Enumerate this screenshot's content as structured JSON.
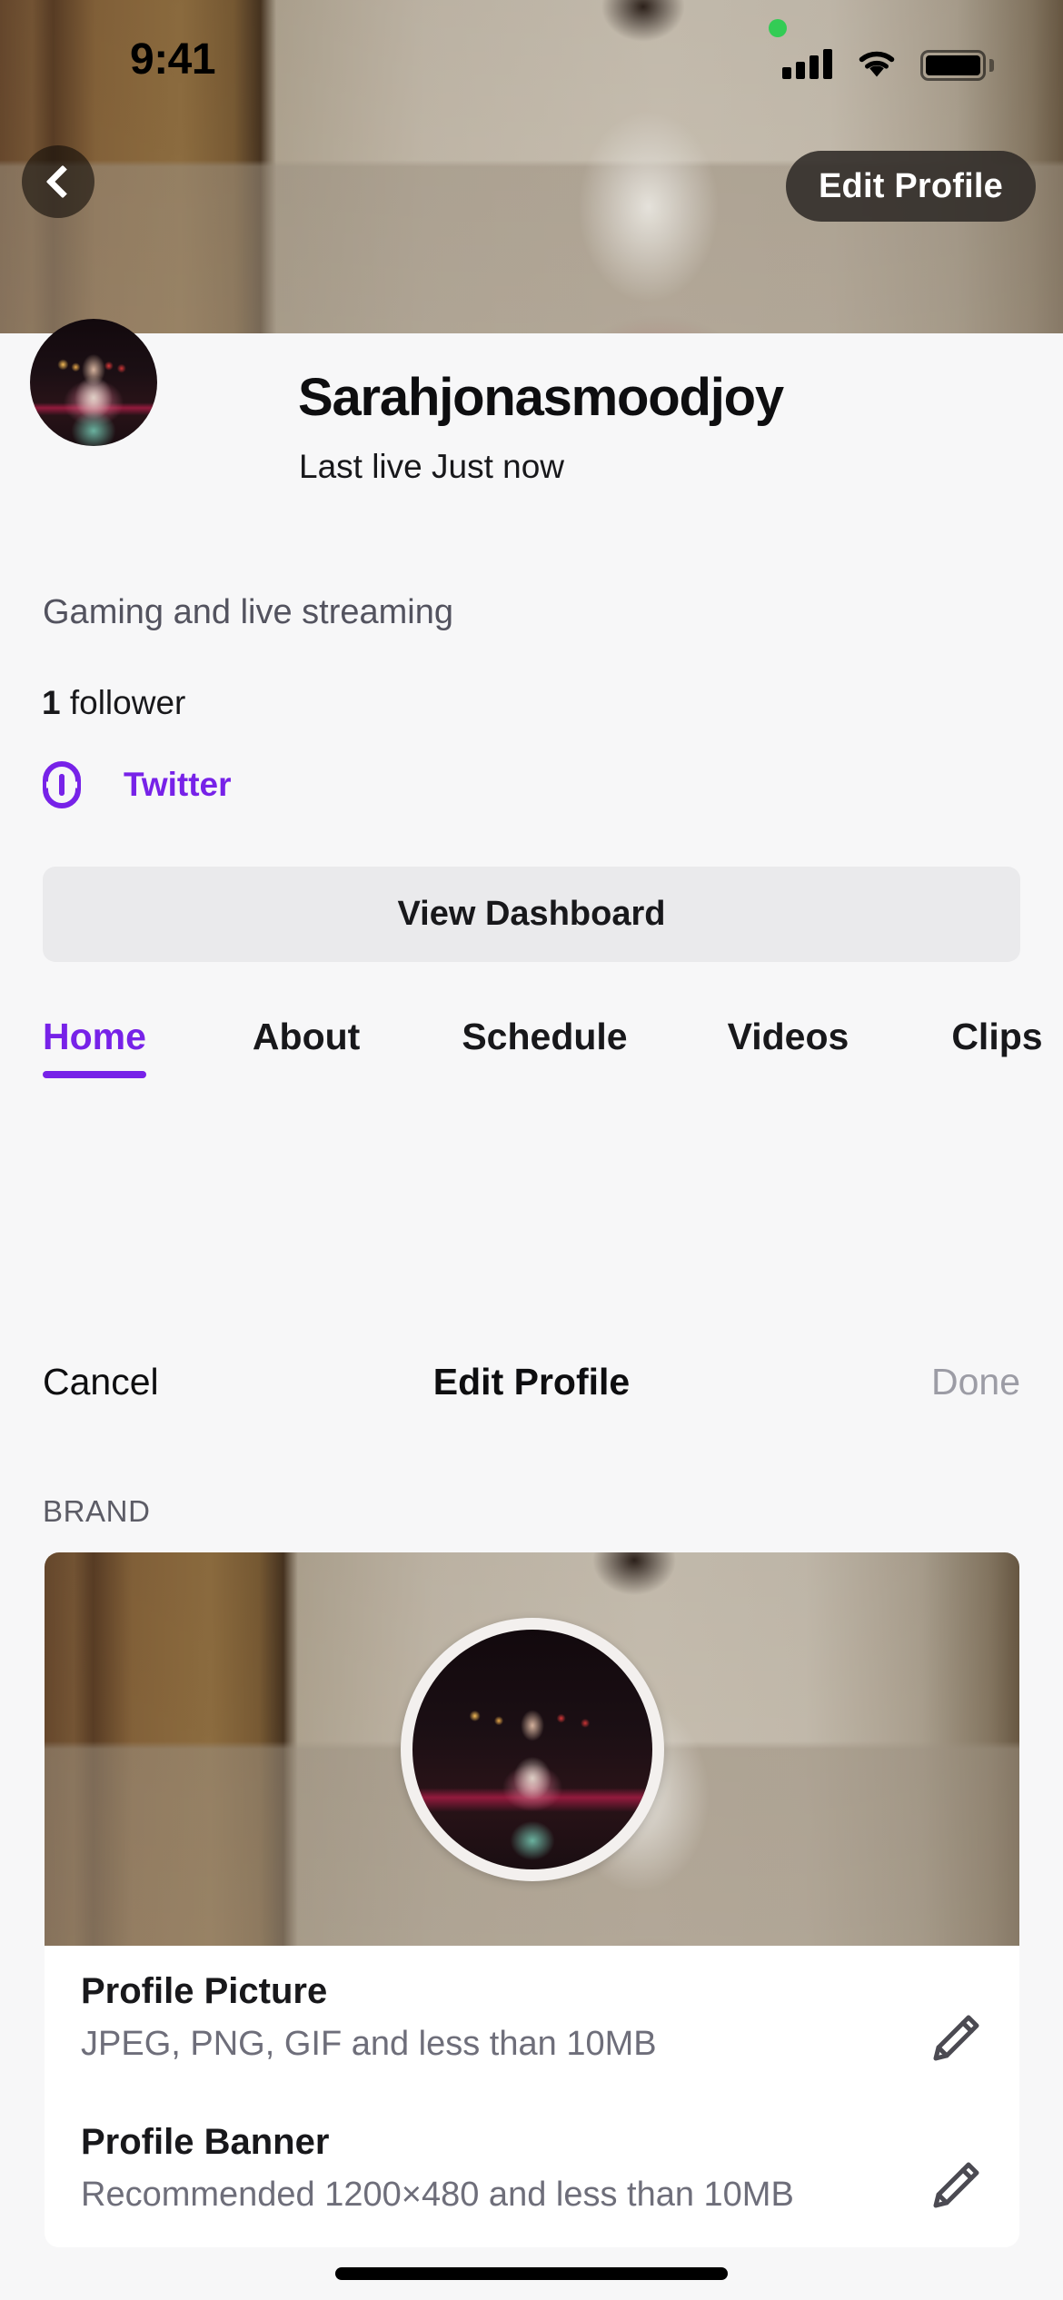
{
  "status_bar": {
    "time": "9:41",
    "icons": [
      "green-recording-dot",
      "cellular-signal-icon",
      "wifi-icon",
      "battery-icon"
    ],
    "battery_full": true
  },
  "banner_controls": {
    "back_icon": "chevron-left-icon",
    "edit_profile_label": "Edit Profile"
  },
  "profile": {
    "avatar_alt": "profile-avatar",
    "name": "Sarahjonasmoodjoy",
    "last_live": "Last live Just now",
    "bio": "Gaming and live streaming",
    "followers_count": "1",
    "followers_label": " follower",
    "social": {
      "icon": "link-icon",
      "label": "Twitter"
    },
    "dashboard_button": "View Dashboard"
  },
  "tabs": [
    {
      "label": "Home",
      "active": true
    },
    {
      "label": "About",
      "active": false
    },
    {
      "label": "Schedule",
      "active": false
    },
    {
      "label": "Videos",
      "active": false
    },
    {
      "label": "Clips",
      "active": false
    }
  ],
  "edit_sheet": {
    "cancel_label": "Cancel",
    "title": "Edit Profile",
    "done_label": "Done",
    "section_label": "BRAND",
    "rows": [
      {
        "title": "Profile Picture",
        "subtitle": "JPEG, PNG, GIF and less than 10MB",
        "action_icon": "pencil-icon"
      },
      {
        "title": "Profile Banner",
        "subtitle": "Recommended 1200×480 and less than 10MB",
        "action_icon": "pencil-icon"
      }
    ]
  },
  "colors": {
    "accent_purple": "#7722E8",
    "page_background": "#F7F7F8",
    "card_background": "#FFFFFF",
    "primary_text": "#18181B",
    "secondary_text": "#6E6E7A",
    "disabled_text": "#9C9CA5",
    "button_background": "#EAEAEC",
    "status_green": "#33CC55"
  }
}
